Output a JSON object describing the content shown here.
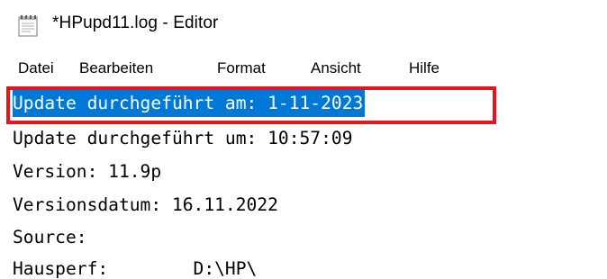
{
  "window": {
    "title": "*HPupd11.log - Editor",
    "icon": "notepad-icon"
  },
  "menubar": {
    "items": [
      "Datei",
      "Bearbeiten",
      "Format",
      "Ansicht",
      "Hilfe"
    ]
  },
  "editor": {
    "lines": [
      "Update durchgeführt am: 1-11-2023",
      "Update durchgeführt um: 10:57:09",
      "Version: 11.9p",
      "Versionsdatum: 16.11.2022",
      "Source:",
      "Hausperf:        D:\\HP\\"
    ],
    "selected_line_index": 0
  },
  "colors": {
    "selection_background": "#0078d7",
    "selection_text": "#ffffff",
    "annotation_border": "#e8141c"
  }
}
